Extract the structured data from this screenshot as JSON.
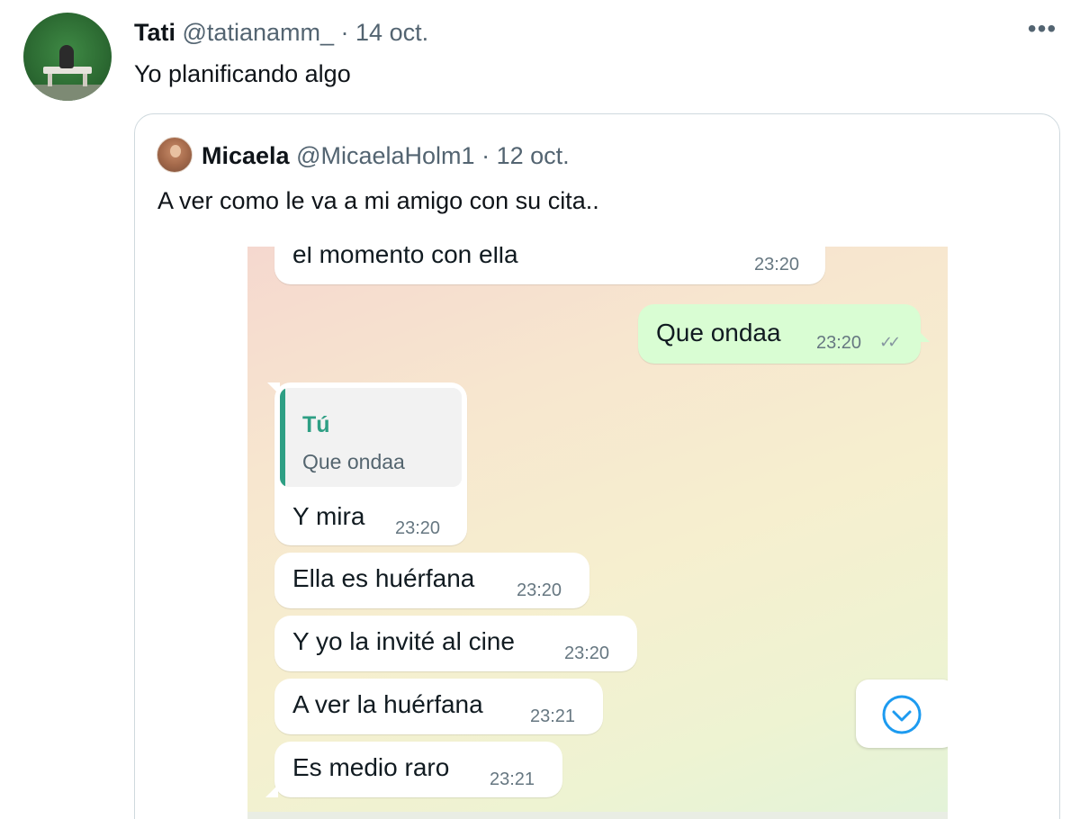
{
  "tweet": {
    "author_name": "Tati",
    "handle": "@tatianamm_",
    "separator": "·",
    "date": "14 oct.",
    "text": "Yo planificando algo",
    "more_icon": "more-horizontal-icon"
  },
  "quoted_tweet": {
    "author_name": "Micaela",
    "handle": "@MicaelaHolm1",
    "separator": "·",
    "date": "12 oct.",
    "text": "A ver como le va a mi amigo con su cita.."
  },
  "chat": {
    "messages": [
      {
        "text": "el momento con ella",
        "time": "23:20",
        "direction": "in"
      },
      {
        "text": "Que ondaa",
        "time": "23:20",
        "direction": "out",
        "status": "read-ticks-icon"
      },
      {
        "text": "Y mira",
        "time": "23:20",
        "direction": "in",
        "reply_to": {
          "author": "Tú",
          "text": "Que ondaa"
        }
      },
      {
        "text": "Ella es huérfana",
        "time": "23:20",
        "direction": "in"
      },
      {
        "text": "Y yo la invité al cine",
        "time": "23:20",
        "direction": "in"
      },
      {
        "text": "A ver la huérfana",
        "time": "23:21",
        "direction": "in"
      },
      {
        "text": "Es medio raro",
        "time": "23:21",
        "direction": "in"
      }
    ],
    "scroll_button_icon": "chevron-down-circle-icon",
    "colors": {
      "incoming_bubble": "#ffffff",
      "outgoing_bubble": "#d9fdd3",
      "reply_accent": "#2e9f84",
      "scroll_icon": "#1d9bf0"
    }
  }
}
